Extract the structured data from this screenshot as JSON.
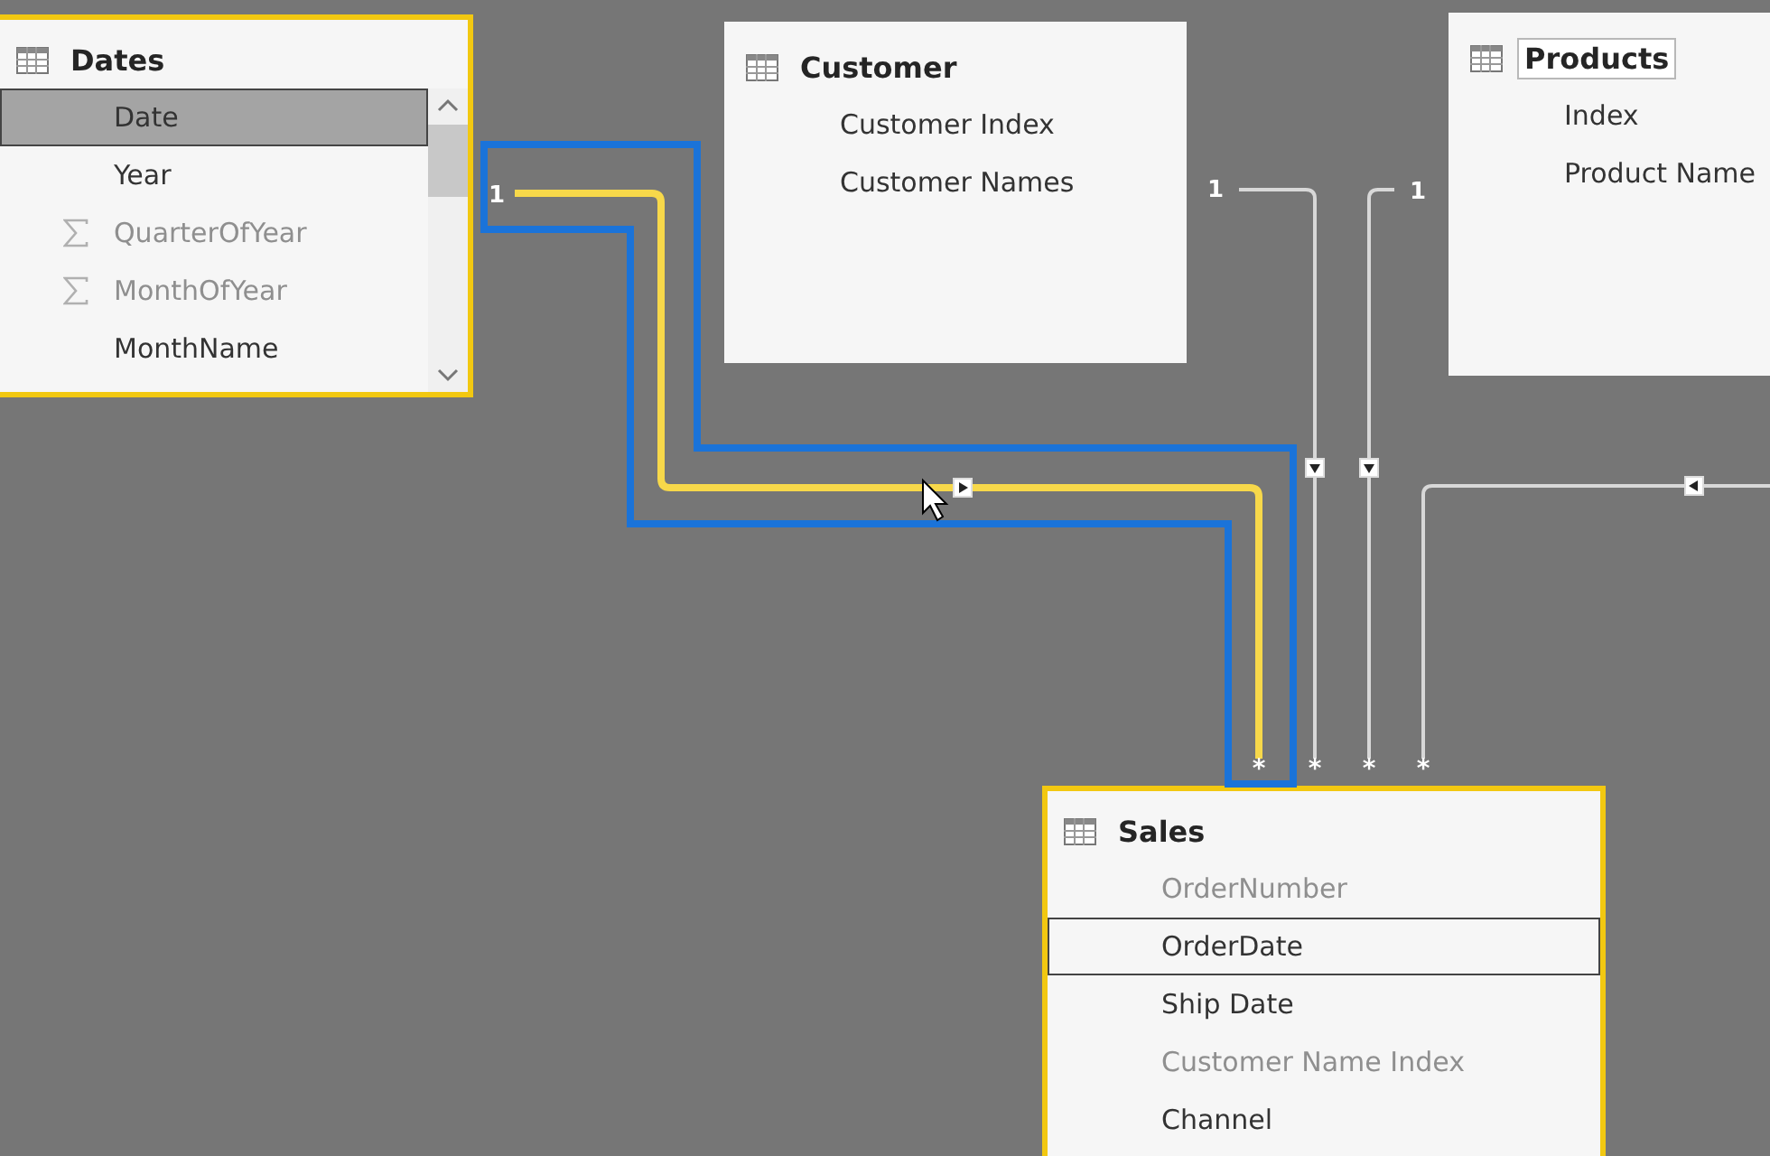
{
  "tables": [
    {
      "name": "Dates",
      "selected": true,
      "title_focused": false,
      "scrollbar": true,
      "fields": [
        {
          "name": "Date",
          "selected": true,
          "highlighted": true,
          "hidden": false,
          "summarized": false
        },
        {
          "name": "Year",
          "selected": false,
          "highlighted": false,
          "hidden": false,
          "summarized": false
        },
        {
          "name": "QuarterOfYear",
          "selected": false,
          "highlighted": false,
          "hidden": true,
          "summarized": true
        },
        {
          "name": "MonthOfYear",
          "selected": false,
          "highlighted": false,
          "hidden": true,
          "summarized": true
        },
        {
          "name": "MonthName",
          "selected": false,
          "highlighted": false,
          "hidden": false,
          "summarized": false
        }
      ]
    },
    {
      "name": "Customer",
      "selected": false,
      "title_focused": false,
      "scrollbar": false,
      "fields": [
        {
          "name": "Customer Index",
          "selected": false,
          "highlighted": false,
          "hidden": false,
          "summarized": false
        },
        {
          "name": "Customer Names",
          "selected": false,
          "highlighted": false,
          "hidden": false,
          "summarized": false
        }
      ]
    },
    {
      "name": "Products",
      "selected": false,
      "title_focused": true,
      "scrollbar": false,
      "fields": [
        {
          "name": "Index",
          "selected": false,
          "highlighted": false,
          "hidden": false,
          "summarized": false
        },
        {
          "name": "Product Name",
          "selected": false,
          "highlighted": false,
          "hidden": false,
          "summarized": false
        }
      ]
    },
    {
      "name": "Sales",
      "selected": true,
      "title_focused": false,
      "scrollbar": false,
      "fields": [
        {
          "name": "OrderNumber",
          "selected": false,
          "highlighted": false,
          "hidden": true,
          "summarized": false
        },
        {
          "name": "OrderDate",
          "selected": true,
          "highlighted": false,
          "hidden": false,
          "summarized": false
        },
        {
          "name": "Ship Date",
          "selected": false,
          "highlighted": false,
          "hidden": false,
          "summarized": false
        },
        {
          "name": "Customer Name Index",
          "selected": false,
          "highlighted": false,
          "hidden": true,
          "summarized": false
        },
        {
          "name": "Channel",
          "selected": false,
          "highlighted": false,
          "hidden": false,
          "summarized": false
        }
      ]
    }
  ],
  "relationships": [
    {
      "one_label": "1",
      "many_label": "*",
      "selected": true
    },
    {
      "one_label": "1",
      "many_label": "*",
      "selected": false
    },
    {
      "one_label": "1",
      "many_label": "*",
      "selected": false
    },
    {
      "many_label": "*",
      "selected": false
    }
  ]
}
